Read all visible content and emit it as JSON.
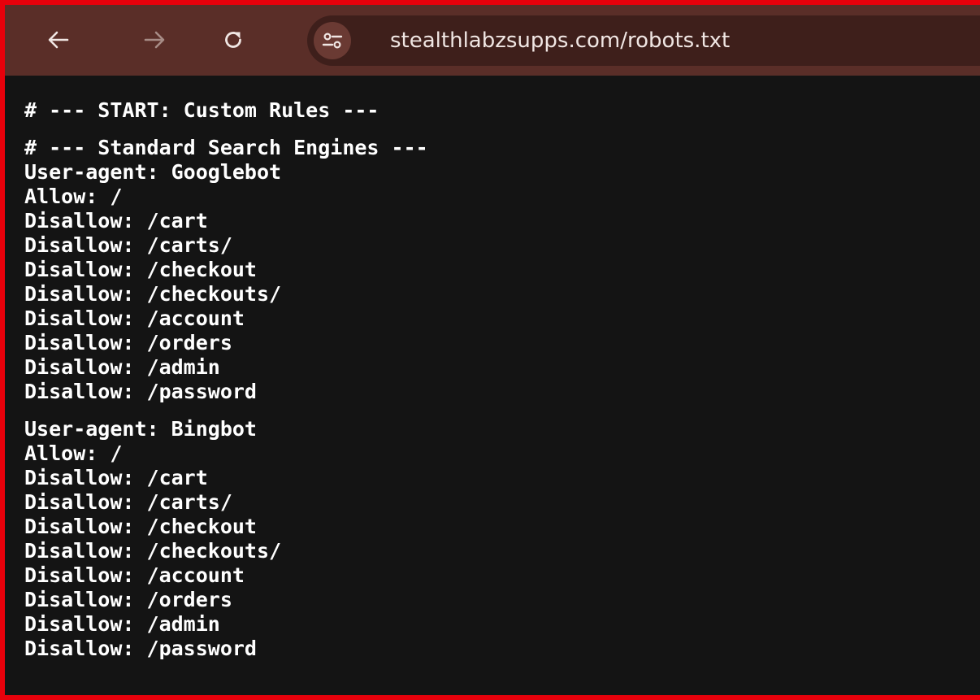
{
  "browser": {
    "url": "stealthlabzsupps.com/robots.txt",
    "icons": {
      "back": "back-arrow-icon",
      "forward": "forward-arrow-icon",
      "reload": "reload-icon",
      "site_info": "site-settings-icon"
    },
    "colors": {
      "toolbar": "#5a2e28",
      "omnibox": "#3e1f1b",
      "page_background": "#141414",
      "highlight_border": "#e8000b"
    }
  },
  "robots": {
    "header": "# --- START: Custom Rules ---",
    "sections": [
      {
        "lines": [
          "# --- Standard Search Engines ---",
          "User-agent: Googlebot",
          "Allow: /",
          "Disallow: /cart",
          "Disallow: /carts/",
          "Disallow: /checkout",
          "Disallow: /checkouts/",
          "Disallow: /account",
          "Disallow: /orders",
          "Disallow: /admin",
          "Disallow: /password"
        ]
      },
      {
        "lines": [
          "User-agent: Bingbot",
          "Allow: /",
          "Disallow: /cart",
          "Disallow: /carts/",
          "Disallow: /checkout",
          "Disallow: /checkouts/",
          "Disallow: /account",
          "Disallow: /orders",
          "Disallow: /admin",
          "Disallow: /password"
        ]
      }
    ]
  }
}
